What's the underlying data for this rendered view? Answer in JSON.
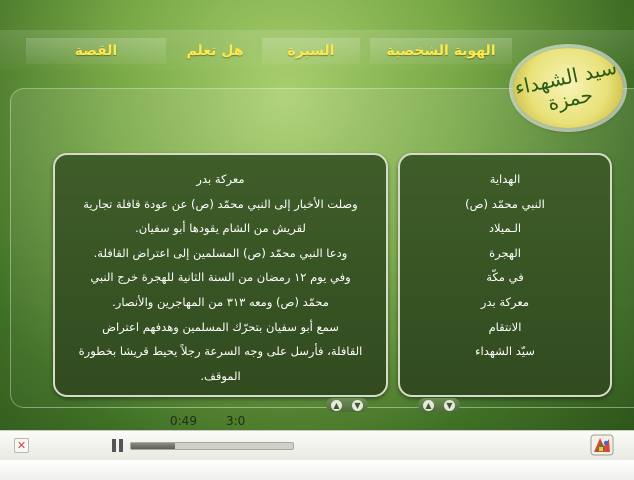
{
  "nav": {
    "tabs": [
      {
        "label": "الهوية الشخصية"
      },
      {
        "label": "السيرة"
      },
      {
        "label": "هل تعلم"
      },
      {
        "label": "القصة"
      }
    ]
  },
  "logo": {
    "text": "سيد الشهداء حمزة"
  },
  "story": {
    "title": "معركة بدر",
    "lines": [
      "وصلت الأخبار إلى النبي محمّد (ص) عن عودة قافلة تجارية",
      "لقريش من الشام يقودها أبو سفيان.",
      "ودعا النبي محمّد (ص) المسلمين إلى اعتراض القافلة.",
      "وفي يوم ١٢ رمضان من السنة الثانية للهجرة خرج النبي",
      "محمّد (ص) ومعه ٣١٣ من المهاجرين والأنصار.",
      "سمع أبو سفيان بتحرّك المسلمين وهدفهم اعتراض",
      "القافلة، فأرسل على وجه السرعة رجلاً يحيط قريشا بخطورة",
      "الموقف."
    ]
  },
  "menu": {
    "items": [
      {
        "label": "الهداية"
      },
      {
        "label": "النبي محمّد (ص)"
      },
      {
        "label": "الـميلاد"
      },
      {
        "label": "الهجرة"
      },
      {
        "label": "في مكّة"
      },
      {
        "label": "معركة بدر"
      },
      {
        "label": "الانتقام"
      },
      {
        "label": "سيّد الشهداء"
      }
    ]
  },
  "player": {
    "elapsed": "0:49",
    "duration": "3:0",
    "progress": 0.27
  },
  "icons": {
    "close": "close-icon",
    "pause": "pause-icon",
    "scroll_up": "arrow-up-icon",
    "scroll_down": "arrow-down-icon",
    "mascot": "mascot-icon"
  },
  "colors": {
    "tab_text": "#ffe94a",
    "panel_bg": "#3f5d29",
    "panel_border": "#d6dbc9"
  }
}
